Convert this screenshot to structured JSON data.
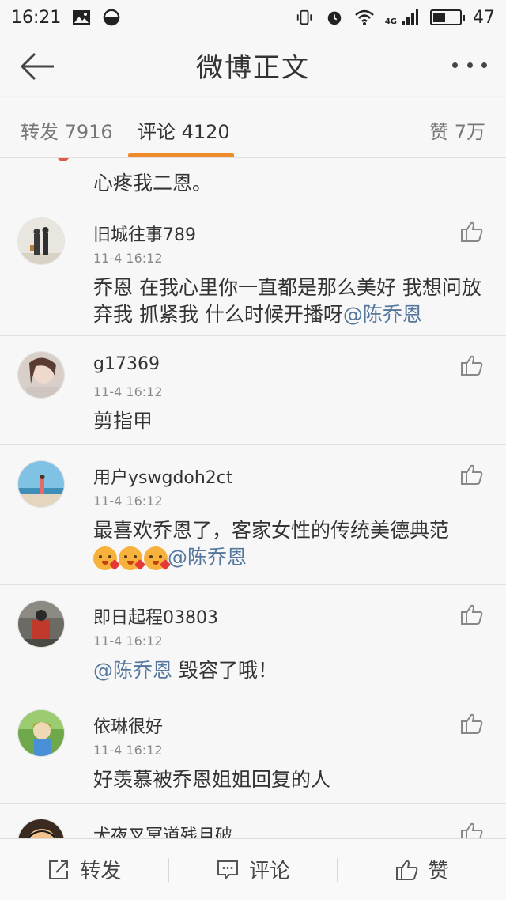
{
  "status_bar": {
    "time": "16:21",
    "network": "4G",
    "battery_percent": "47",
    "battery_level": 0.47
  },
  "nav": {
    "title": "微博正文",
    "back_icon": "arrow-left-icon",
    "more_icon": "more-dots-icon"
  },
  "tabs": {
    "repost": "转发 7916",
    "comment": "评论 4120",
    "like": "赞 7万",
    "active": "comment",
    "accent_color": "#f08b2c"
  },
  "partial_comment": {
    "text": "心疼我二恩。"
  },
  "comments": [
    {
      "user": "旧城往事789",
      "time": "11-4 16:12",
      "text": "乔恩 在我心里你一直都是那么美好 我想问放弃我 抓紧我 什么时候开播呀",
      "mention": "@陈乔恩"
    },
    {
      "user": "g17369",
      "time": "11-4 16:12",
      "text": "剪指甲",
      "mention": ""
    },
    {
      "user": "用户yswgdoh2ct",
      "time": "11-4 16:12",
      "text": "最喜欢乔恩了，客家女性的传统美德典范",
      "mention": "@陈乔恩"
    },
    {
      "user": "即日起程03803",
      "time": "11-4 16:12",
      "text": "毁容了哦！",
      "mention": "@陈乔恩"
    },
    {
      "user": "依琳很好",
      "time": "11-4 16:12",
      "text": "好羡慕被乔恩姐姐回复的人",
      "mention": ""
    },
    {
      "user": "犬夜叉冥道残月破",
      "time": "",
      "text": "",
      "mention": ""
    }
  ],
  "bottom_bar": {
    "repost": "转发",
    "comment": "评论",
    "like": "赞"
  },
  "colors": {
    "mention": "#55779e",
    "background": "#f7f7f7"
  }
}
